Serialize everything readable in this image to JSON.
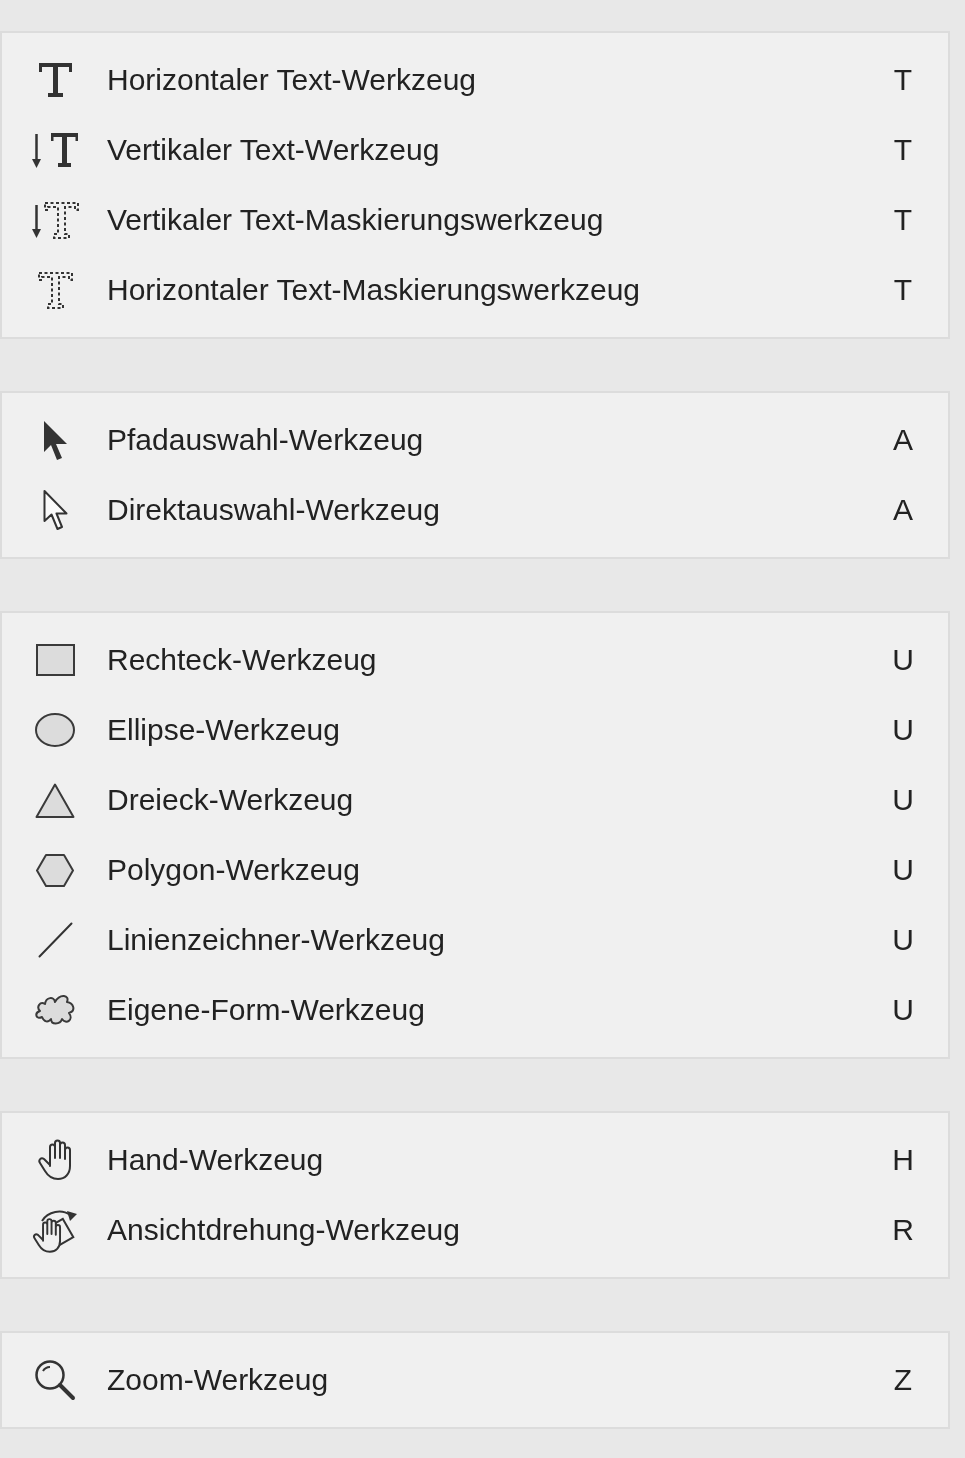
{
  "groups": [
    {
      "items": [
        {
          "kind": "text",
          "label": "Horizontaler Text-Werkzeug",
          "shortcut": "T"
        },
        {
          "kind": "vtext",
          "label": "Vertikaler Text-Werkzeug",
          "shortcut": "T"
        },
        {
          "kind": "vmask",
          "label": "Vertikaler Text-Maskierungswerkzeug",
          "shortcut": "T"
        },
        {
          "kind": "hmask",
          "label": "Horizontaler Text-Maskierungswerkzeug",
          "shortcut": "T"
        }
      ]
    },
    {
      "items": [
        {
          "kind": "path",
          "label": "Pfadauswahl-Werkzeug",
          "shortcut": "A"
        },
        {
          "kind": "direct",
          "label": "Direktauswahl-Werkzeug",
          "shortcut": "A"
        }
      ]
    },
    {
      "items": [
        {
          "kind": "rectangle",
          "label": "Rechteck-Werkzeug",
          "shortcut": "U"
        },
        {
          "kind": "ellipse",
          "label": "Ellipse-Werkzeug",
          "shortcut": "U"
        },
        {
          "kind": "triangle",
          "label": "Dreieck-Werkzeug",
          "shortcut": "U"
        },
        {
          "kind": "polygon",
          "label": "Polygon-Werkzeug",
          "shortcut": "U"
        },
        {
          "kind": "line",
          "label": "Linienzeichner-Werkzeug",
          "shortcut": "U"
        },
        {
          "kind": "shape",
          "label": "Eigene-Form-Werkzeug",
          "shortcut": "U"
        }
      ]
    },
    {
      "items": [
        {
          "kind": "hand",
          "label": "Hand-Werkzeug",
          "shortcut": "H"
        },
        {
          "kind": "rotate",
          "label": "Ansichtdrehung-Werkzeug",
          "shortcut": "R"
        }
      ]
    },
    {
      "items": [
        {
          "kind": "zoom",
          "label": "Zoom-Werkzeug",
          "shortcut": "Z"
        }
      ]
    }
  ]
}
